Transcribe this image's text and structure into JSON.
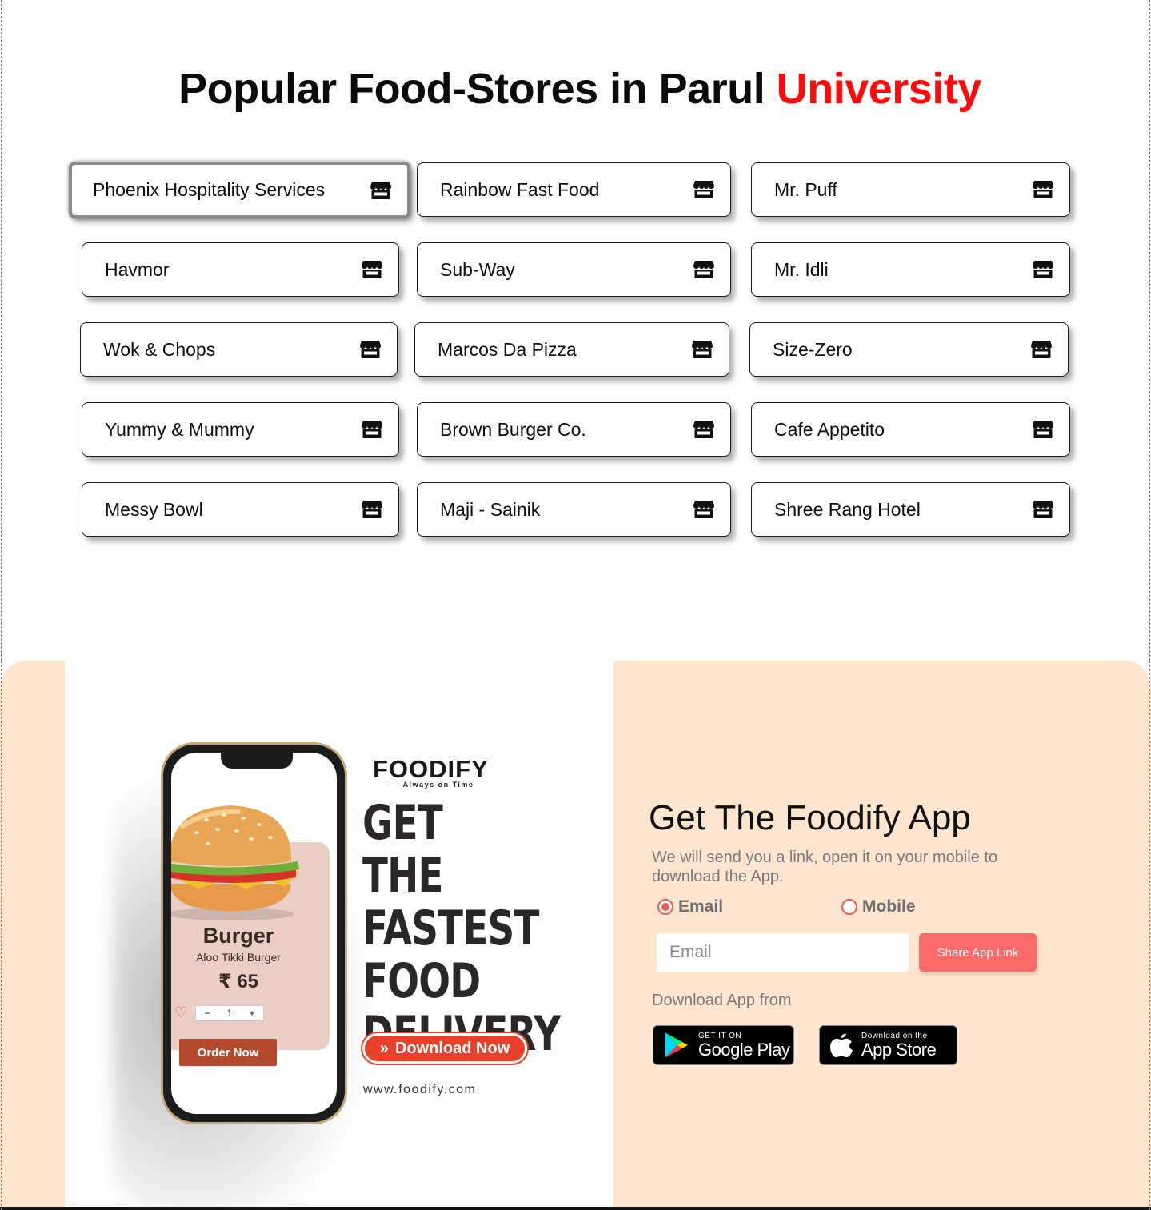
{
  "heading": {
    "main": "Popular Food-Stores in Parul ",
    "accent": "University"
  },
  "stores": [
    {
      "name": "Phoenix Hospitality Services",
      "icon": "storefront-icon"
    },
    {
      "name": "Rainbow Fast Food",
      "icon": "storefront-icon"
    },
    {
      "name": "Mr. Puff",
      "icon": "storefront-icon"
    },
    {
      "name": "Havmor",
      "icon": "storefront-icon"
    },
    {
      "name": "Sub-Way",
      "icon": "storefront-icon"
    },
    {
      "name": "Mr. Idli",
      "icon": "storefront-icon"
    },
    {
      "name": "Wok & Chops",
      "icon": "storefront-icon"
    },
    {
      "name": "Marcos Da Pizza",
      "icon": "storefront-icon"
    },
    {
      "name": "Size-Zero",
      "icon": "storefront-icon"
    },
    {
      "name": "Yummy & Mummy",
      "icon": "storefront-icon"
    },
    {
      "name": "Brown Burger Co.",
      "icon": "storefront-icon"
    },
    {
      "name": "Cafe Appetito",
      "icon": "storefront-icon"
    },
    {
      "name": "Messy Bowl",
      "icon": "storefront-icon"
    },
    {
      "name": "Maji - Sainik",
      "icon": "storefront-icon"
    },
    {
      "name": "Shree Rang Hotel",
      "icon": "storefront-icon"
    }
  ],
  "banner": {
    "brand": "FOODIFY",
    "tagline": "Always on Time",
    "headline": [
      "GET THE",
      "FASTEST",
      "FOOD",
      "DELIVERY"
    ],
    "download_label": "Download Now",
    "website": "www.foodify.com",
    "phone": {
      "item_title": "Burger",
      "item_subtitle": "Aloo Tikki Burger",
      "price": "₹ 65",
      "quantity": "1",
      "minus": "−",
      "plus": "+",
      "order_label": "Order Now"
    }
  },
  "app": {
    "title": "Get The Foodify App",
    "description": "We will send you a link, open it on your mobile to download the App.",
    "options": [
      {
        "label": "Email",
        "checked": true
      },
      {
        "label": "Mobile",
        "checked": false
      }
    ],
    "input_placeholder": "Email",
    "share_label": "Share App Link",
    "download_from": "Download App from",
    "google_play": {
      "small": "GET IT ON",
      "big": "Google Play"
    },
    "app_store": {
      "small": "Download on the",
      "big": "App Store"
    }
  },
  "colors": {
    "accent_red": "#ff0a0a",
    "footer_peach": "#fde5cf",
    "share_button": "#f96a68",
    "download_button": "#e8402a"
  }
}
